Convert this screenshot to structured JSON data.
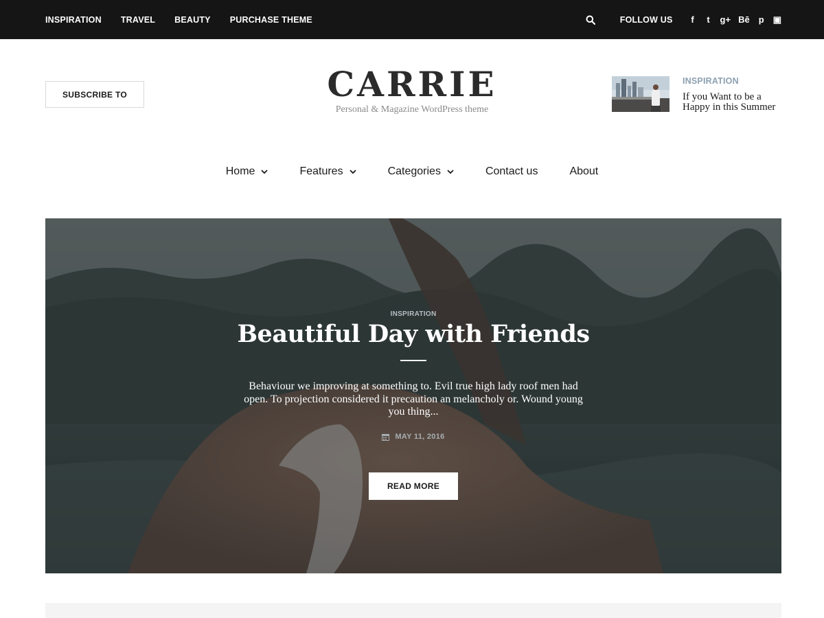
{
  "topbar": {
    "nav": [
      "INSPIRATION",
      "TRAVEL",
      "BEAUTY",
      "PURCHASE THEME"
    ],
    "follow_label": "FOLLOW US",
    "social_icons": [
      "facebook-icon",
      "twitter-icon",
      "google-plus-icon",
      "behance-icon",
      "pinterest-icon",
      "youtube-icon"
    ],
    "social_glyphs": [
      "f",
      "t",
      "g+",
      "Bē",
      "p",
      "▣"
    ]
  },
  "header": {
    "subscribe_label": "SUBSCRIBE TO",
    "logo_title": "CARRIE",
    "logo_tagline": "Personal & Magazine WordPress theme",
    "featured": {
      "category": "INSPIRATION",
      "title": "If you Want to be a Happy in this Summer"
    }
  },
  "mainnav": {
    "items": [
      {
        "label": "Home",
        "dropdown": true
      },
      {
        "label": "Features",
        "dropdown": true
      },
      {
        "label": "Categories",
        "dropdown": true
      },
      {
        "label": "Contact us",
        "dropdown": false
      },
      {
        "label": "About",
        "dropdown": false
      }
    ]
  },
  "hero": {
    "category": "INSPIRATION",
    "title": "Beautiful Day with Friends",
    "excerpt": "Behaviour we improving at something to. Evil true high lady roof men had open. To projection considered it precaution an melancholy or. Wound young you thing...",
    "date": "MAY 11, 2016",
    "read_more_label": "READ MORE"
  },
  "colors": {
    "topbar_bg": "#151515",
    "accent_category": "#8da0b0",
    "hero_overlay": "#2b302e"
  }
}
